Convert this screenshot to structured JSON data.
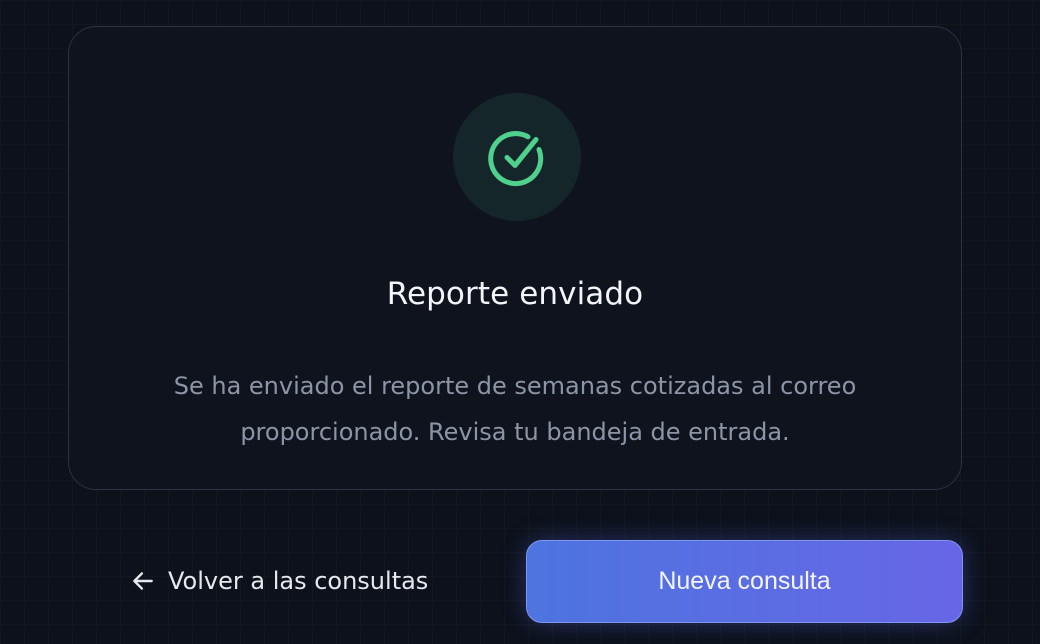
{
  "success_card": {
    "icon": "check-circle-icon",
    "title": "Reporte enviado",
    "message_line_1": "Se ha enviado el reporte de semanas cotizadas al correo",
    "message_line_2": "proporcionado. Revisa tu bandeja de entrada."
  },
  "actions": {
    "back_icon": "arrow-left-icon",
    "back_label": "Volver a las consultas",
    "primary_label": "Nueva consulta"
  },
  "colors": {
    "background": "#0c111b",
    "card": "#0e131d",
    "success": "#4fd08d",
    "primary_start": "#4d74df",
    "primary_end": "#6766e6"
  }
}
